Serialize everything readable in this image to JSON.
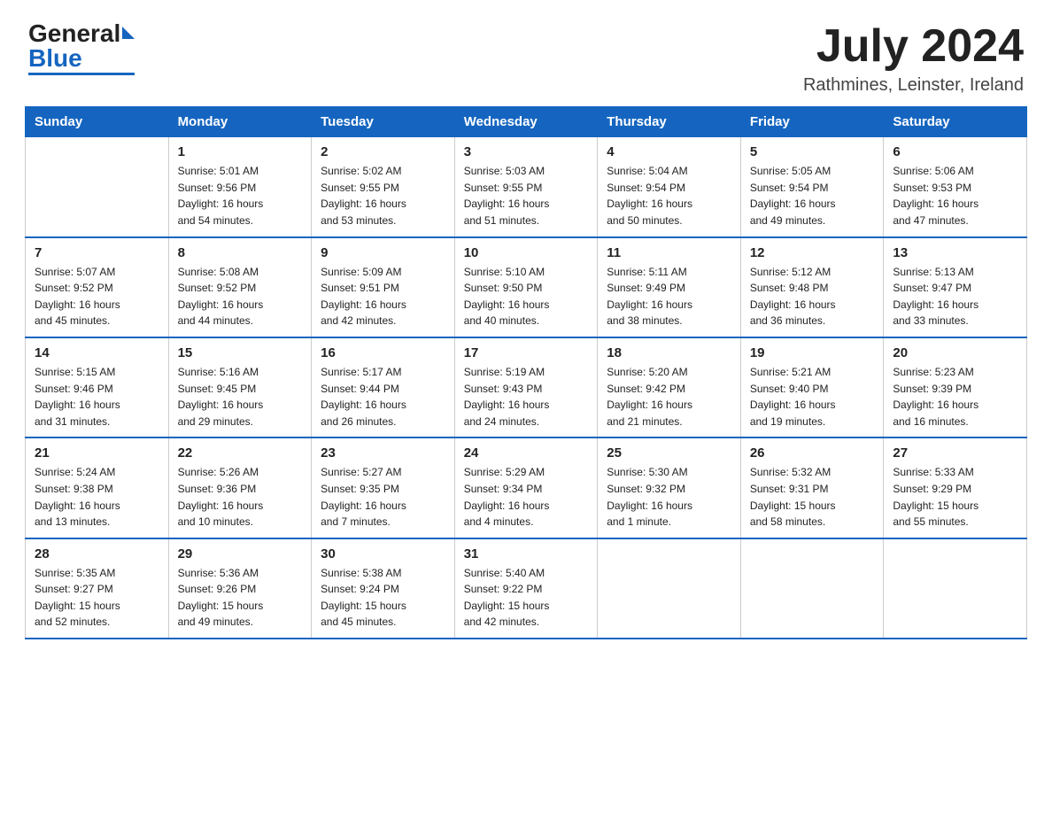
{
  "logo": {
    "general": "General",
    "blue": "Blue"
  },
  "title": "July 2024",
  "subtitle": "Rathmines, Leinster, Ireland",
  "days_of_week": [
    "Sunday",
    "Monday",
    "Tuesday",
    "Wednesday",
    "Thursday",
    "Friday",
    "Saturday"
  ],
  "weeks": [
    [
      {
        "day": "",
        "info": ""
      },
      {
        "day": "1",
        "info": "Sunrise: 5:01 AM\nSunset: 9:56 PM\nDaylight: 16 hours\nand 54 minutes."
      },
      {
        "day": "2",
        "info": "Sunrise: 5:02 AM\nSunset: 9:55 PM\nDaylight: 16 hours\nand 53 minutes."
      },
      {
        "day": "3",
        "info": "Sunrise: 5:03 AM\nSunset: 9:55 PM\nDaylight: 16 hours\nand 51 minutes."
      },
      {
        "day": "4",
        "info": "Sunrise: 5:04 AM\nSunset: 9:54 PM\nDaylight: 16 hours\nand 50 minutes."
      },
      {
        "day": "5",
        "info": "Sunrise: 5:05 AM\nSunset: 9:54 PM\nDaylight: 16 hours\nand 49 minutes."
      },
      {
        "day": "6",
        "info": "Sunrise: 5:06 AM\nSunset: 9:53 PM\nDaylight: 16 hours\nand 47 minutes."
      }
    ],
    [
      {
        "day": "7",
        "info": "Sunrise: 5:07 AM\nSunset: 9:52 PM\nDaylight: 16 hours\nand 45 minutes."
      },
      {
        "day": "8",
        "info": "Sunrise: 5:08 AM\nSunset: 9:52 PM\nDaylight: 16 hours\nand 44 minutes."
      },
      {
        "day": "9",
        "info": "Sunrise: 5:09 AM\nSunset: 9:51 PM\nDaylight: 16 hours\nand 42 minutes."
      },
      {
        "day": "10",
        "info": "Sunrise: 5:10 AM\nSunset: 9:50 PM\nDaylight: 16 hours\nand 40 minutes."
      },
      {
        "day": "11",
        "info": "Sunrise: 5:11 AM\nSunset: 9:49 PM\nDaylight: 16 hours\nand 38 minutes."
      },
      {
        "day": "12",
        "info": "Sunrise: 5:12 AM\nSunset: 9:48 PM\nDaylight: 16 hours\nand 36 minutes."
      },
      {
        "day": "13",
        "info": "Sunrise: 5:13 AM\nSunset: 9:47 PM\nDaylight: 16 hours\nand 33 minutes."
      }
    ],
    [
      {
        "day": "14",
        "info": "Sunrise: 5:15 AM\nSunset: 9:46 PM\nDaylight: 16 hours\nand 31 minutes."
      },
      {
        "day": "15",
        "info": "Sunrise: 5:16 AM\nSunset: 9:45 PM\nDaylight: 16 hours\nand 29 minutes."
      },
      {
        "day": "16",
        "info": "Sunrise: 5:17 AM\nSunset: 9:44 PM\nDaylight: 16 hours\nand 26 minutes."
      },
      {
        "day": "17",
        "info": "Sunrise: 5:19 AM\nSunset: 9:43 PM\nDaylight: 16 hours\nand 24 minutes."
      },
      {
        "day": "18",
        "info": "Sunrise: 5:20 AM\nSunset: 9:42 PM\nDaylight: 16 hours\nand 21 minutes."
      },
      {
        "day": "19",
        "info": "Sunrise: 5:21 AM\nSunset: 9:40 PM\nDaylight: 16 hours\nand 19 minutes."
      },
      {
        "day": "20",
        "info": "Sunrise: 5:23 AM\nSunset: 9:39 PM\nDaylight: 16 hours\nand 16 minutes."
      }
    ],
    [
      {
        "day": "21",
        "info": "Sunrise: 5:24 AM\nSunset: 9:38 PM\nDaylight: 16 hours\nand 13 minutes."
      },
      {
        "day": "22",
        "info": "Sunrise: 5:26 AM\nSunset: 9:36 PM\nDaylight: 16 hours\nand 10 minutes."
      },
      {
        "day": "23",
        "info": "Sunrise: 5:27 AM\nSunset: 9:35 PM\nDaylight: 16 hours\nand 7 minutes."
      },
      {
        "day": "24",
        "info": "Sunrise: 5:29 AM\nSunset: 9:34 PM\nDaylight: 16 hours\nand 4 minutes."
      },
      {
        "day": "25",
        "info": "Sunrise: 5:30 AM\nSunset: 9:32 PM\nDaylight: 16 hours\nand 1 minute."
      },
      {
        "day": "26",
        "info": "Sunrise: 5:32 AM\nSunset: 9:31 PM\nDaylight: 15 hours\nand 58 minutes."
      },
      {
        "day": "27",
        "info": "Sunrise: 5:33 AM\nSunset: 9:29 PM\nDaylight: 15 hours\nand 55 minutes."
      }
    ],
    [
      {
        "day": "28",
        "info": "Sunrise: 5:35 AM\nSunset: 9:27 PM\nDaylight: 15 hours\nand 52 minutes."
      },
      {
        "day": "29",
        "info": "Sunrise: 5:36 AM\nSunset: 9:26 PM\nDaylight: 15 hours\nand 49 minutes."
      },
      {
        "day": "30",
        "info": "Sunrise: 5:38 AM\nSunset: 9:24 PM\nDaylight: 15 hours\nand 45 minutes."
      },
      {
        "day": "31",
        "info": "Sunrise: 5:40 AM\nSunset: 9:22 PM\nDaylight: 15 hours\nand 42 minutes."
      },
      {
        "day": "",
        "info": ""
      },
      {
        "day": "",
        "info": ""
      },
      {
        "day": "",
        "info": ""
      }
    ]
  ]
}
